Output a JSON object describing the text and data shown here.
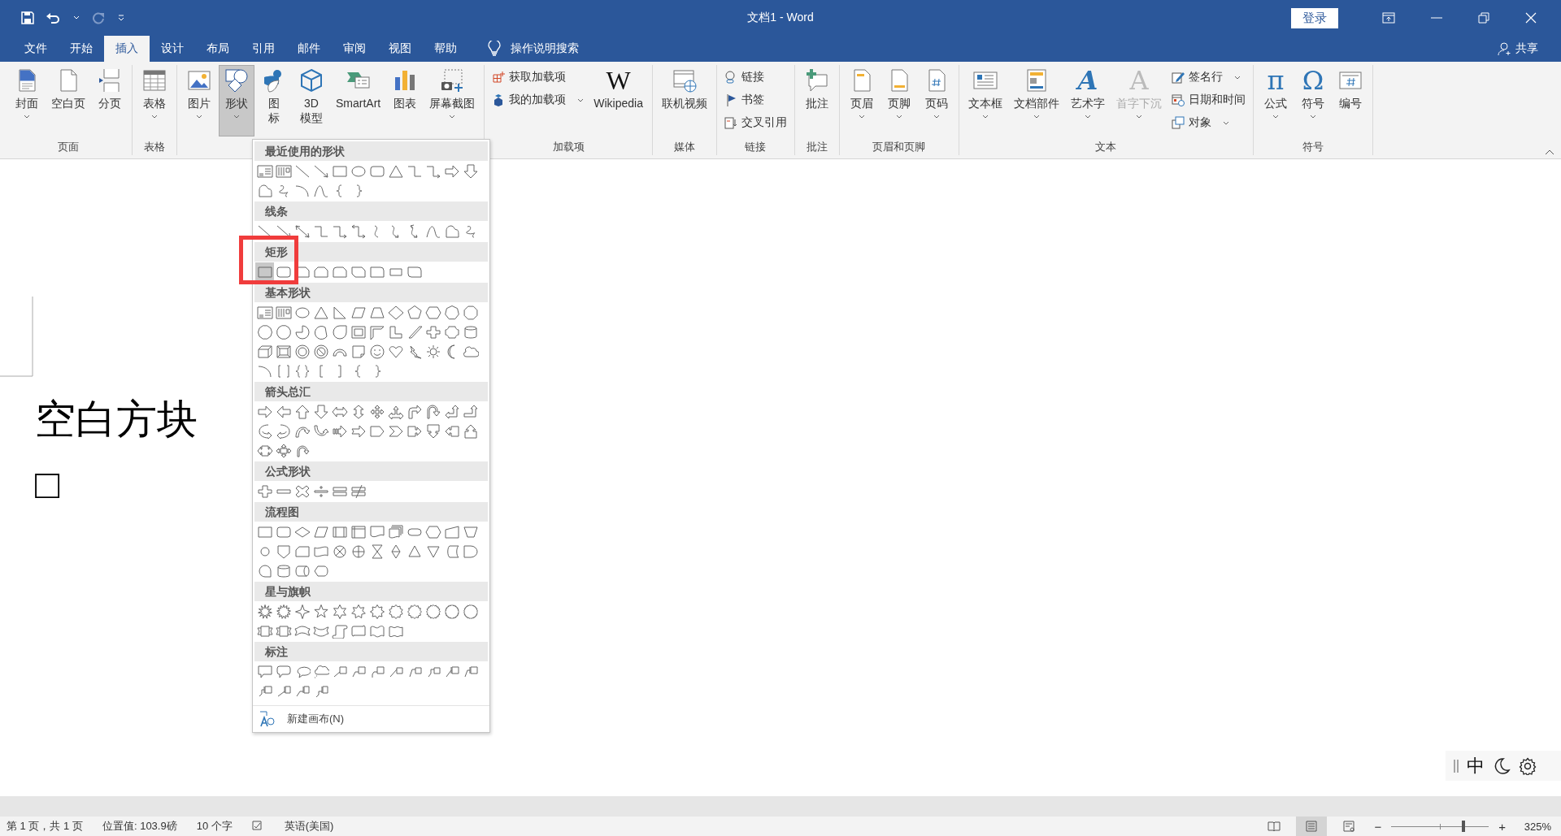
{
  "window": {
    "title": "文档1 - Word",
    "sign_in": "登录"
  },
  "tabs": [
    {
      "label": "文件",
      "selected": false
    },
    {
      "label": "开始",
      "selected": false
    },
    {
      "label": "插入",
      "selected": true
    },
    {
      "label": "设计",
      "selected": false
    },
    {
      "label": "布局",
      "selected": false
    },
    {
      "label": "引用",
      "selected": false
    },
    {
      "label": "邮件",
      "selected": false
    },
    {
      "label": "审阅",
      "selected": false
    },
    {
      "label": "视图",
      "selected": false
    },
    {
      "label": "帮助",
      "selected": false
    }
  ],
  "tell_me": "操作说明搜索",
  "share": "共享",
  "ribbon": {
    "groups": [
      {
        "label": "页面",
        "items": [
          {
            "kind": "large",
            "label": "封面",
            "dropdown": true,
            "pressed": false,
            "disabled": false
          },
          {
            "kind": "large",
            "label": "空白页",
            "dropdown": false,
            "pressed": false,
            "disabled": false
          },
          {
            "kind": "large",
            "label": "分页",
            "dropdown": false,
            "pressed": false,
            "disabled": false
          }
        ]
      },
      {
        "label": "表格",
        "items": [
          {
            "kind": "large",
            "label": "表格",
            "dropdown": true,
            "pressed": false,
            "disabled": false
          }
        ]
      },
      {
        "items": [
          {
            "kind": "large",
            "label": "图片",
            "dropdown": true,
            "pressed": false,
            "disabled": false
          },
          {
            "kind": "large",
            "label": "形状",
            "dropdown": true,
            "pressed": true,
            "disabled": false
          },
          {
            "kind": "large",
            "lines": [
              "图",
              "标"
            ],
            "dropdown": false,
            "pressed": false,
            "disabled": false
          },
          {
            "kind": "large",
            "lines": [
              "3D",
              "模型"
            ],
            "dropdown": false,
            "pressed": false,
            "disabled": false
          },
          {
            "kind": "large",
            "label": "SmartArt",
            "dropdown": false,
            "pressed": false,
            "disabled": false
          },
          {
            "kind": "large",
            "label": "图表",
            "dropdown": false,
            "pressed": false,
            "disabled": false
          },
          {
            "kind": "large",
            "label": "屏幕截图",
            "dropdown": true,
            "pressed": false,
            "disabled": false
          }
        ]
      },
      {
        "label": "加载项",
        "items": [
          {
            "kind": "stack",
            "items": [
              {
                "label": "获取加载项",
                "dropdown": false
              },
              {
                "label": "我的加载项",
                "dropdown": true
              }
            ]
          },
          {
            "kind": "large",
            "glyph": "W",
            "label": "Wikipedia",
            "dropdown": false,
            "pressed": false,
            "disabled": false
          }
        ]
      },
      {
        "label": "媒体",
        "items": [
          {
            "kind": "large",
            "label": "联机视频",
            "dropdown": false,
            "pressed": false,
            "disabled": false
          }
        ]
      },
      {
        "label": "链接",
        "items": [
          {
            "kind": "stack",
            "items": [
              {
                "label": "链接",
                "dropdown": false
              },
              {
                "label": "书签",
                "dropdown": false
              },
              {
                "label": "交叉引用",
                "dropdown": false
              }
            ]
          }
        ]
      },
      {
        "label": "批注",
        "items": [
          {
            "kind": "large",
            "label": "批注",
            "dropdown": false,
            "pressed": false,
            "disabled": false
          }
        ]
      },
      {
        "label": "页眉和页脚",
        "items": [
          {
            "kind": "large",
            "label": "页眉",
            "dropdown": true,
            "pressed": false,
            "disabled": false
          },
          {
            "kind": "large",
            "label": "页脚",
            "dropdown": true,
            "pressed": false,
            "disabled": false
          },
          {
            "kind": "large",
            "label": "页码",
            "dropdown": true,
            "pressed": false,
            "disabled": false
          }
        ]
      },
      {
        "label": "文本",
        "items": [
          {
            "kind": "large",
            "label": "文本框",
            "dropdown": true,
            "pressed": false,
            "disabled": false
          },
          {
            "kind": "large",
            "label": "文档部件",
            "dropdown": true,
            "pressed": false,
            "disabled": false
          },
          {
            "kind": "large",
            "glyph": "A",
            "label": "艺术字",
            "dropdown": true,
            "pressed": false,
            "disabled": false
          },
          {
            "kind": "large",
            "glyph": "A",
            "label": "首字下沉",
            "dropdown": true,
            "pressed": false,
            "disabled": true
          },
          {
            "kind": "stack",
            "items": [
              {
                "label": "签名行",
                "dropdown": true
              },
              {
                "label": "日期和时间",
                "dropdown": false
              },
              {
                "label": "对象",
                "dropdown": true
              }
            ]
          }
        ]
      },
      {
        "label": "符号",
        "items": [
          {
            "kind": "large",
            "glyph": "π",
            "label": "公式",
            "dropdown": true,
            "pressed": false,
            "disabled": false
          },
          {
            "kind": "large",
            "glyph": "Ω",
            "label": "符号",
            "dropdown": true,
            "pressed": false,
            "disabled": false
          },
          {
            "kind": "large",
            "label": "编号",
            "dropdown": false,
            "pressed": false,
            "disabled": false
          }
        ]
      }
    ]
  },
  "shapes_menu": {
    "sections": [
      {
        "title": "最近使用的形状",
        "shapes": [
          {
            "kind": "textbox",
            "selected": false
          },
          {
            "kind": "vtextbox",
            "selected": false
          },
          {
            "kind": "line",
            "selected": false
          },
          {
            "kind": "arrowline",
            "selected": false
          },
          {
            "kind": "rect",
            "selected": false
          },
          {
            "kind": "oval",
            "selected": false
          },
          {
            "kind": "roundrect",
            "selected": false
          },
          {
            "kind": "triangle",
            "selected": false
          },
          {
            "kind": "elbow",
            "selected": false
          },
          {
            "kind": "elbowarrow",
            "selected": false
          },
          {
            "kind": "arrowright",
            "selected": false
          },
          {
            "kind": "arrowdown",
            "selected": false
          },
          {
            "kind": "freeform",
            "selected": false
          },
          {
            "kind": "scribble",
            "selected": false
          },
          {
            "kind": "arc",
            "selected": false
          },
          {
            "kind": "wave",
            "selected": false
          },
          {
            "kind": "lbrace",
            "selected": false
          },
          {
            "kind": "rbrace",
            "selected": false
          }
        ]
      },
      {
        "title": "线条",
        "shapes": [
          {
            "kind": "line",
            "selected": false
          },
          {
            "kind": "arrowline",
            "selected": false
          },
          {
            "kind": "dblarrow",
            "selected": false
          },
          {
            "kind": "elbow",
            "selected": false
          },
          {
            "kind": "elbowarrow",
            "selected": false
          },
          {
            "kind": "elbowdbl",
            "selected": false
          },
          {
            "kind": "curve",
            "selected": false
          },
          {
            "kind": "curvearrow",
            "selected": false
          },
          {
            "kind": "curvedbl",
            "selected": false
          },
          {
            "kind": "wave",
            "selected": false
          },
          {
            "kind": "freeform",
            "selected": false
          },
          {
            "kind": "scribble",
            "selected": false
          }
        ]
      },
      {
        "title": "矩形",
        "shapes": [
          {
            "kind": "rect",
            "selected": true
          },
          {
            "kind": "roundrect",
            "selected": false
          },
          {
            "kind": "snip",
            "selected": false
          },
          {
            "kind": "snip2",
            "selected": false
          },
          {
            "kind": "sniprnd",
            "selected": false
          },
          {
            "kind": "snipdiag",
            "selected": false
          },
          {
            "kind": "round1",
            "selected": false
          },
          {
            "kind": "round2",
            "selected": false
          },
          {
            "kind": "rounddiag",
            "selected": false
          }
        ]
      },
      {
        "title": "基本形状",
        "shapes": [
          {
            "kind": "textbox",
            "selected": false
          },
          {
            "kind": "vtextbox",
            "selected": false
          },
          {
            "kind": "oval",
            "selected": false
          },
          {
            "kind": "triangle",
            "selected": false
          },
          {
            "kind": "rtriangle",
            "selected": false
          },
          {
            "kind": "parallelogram",
            "selected": false
          },
          {
            "kind": "trapezoid",
            "selected": false
          },
          {
            "kind": "diamond",
            "selected": false
          },
          {
            "kind": "pentagon",
            "selected": false
          },
          {
            "kind": "hexagon",
            "selected": false
          },
          {
            "kind": "heptagon",
            "selected": false
          },
          {
            "kind": "octagon",
            "selected": false
          },
          {
            "kind": "decagon",
            "selected": false
          },
          {
            "kind": "dodecagon",
            "selected": false
          },
          {
            "kind": "pie",
            "selected": false
          },
          {
            "kind": "chord",
            "selected": false
          },
          {
            "kind": "teardrop",
            "selected": false
          },
          {
            "kind": "frame",
            "selected": false
          },
          {
            "kind": "halfframe",
            "selected": false
          },
          {
            "kind": "lshape",
            "selected": false
          },
          {
            "kind": "diagstripe",
            "selected": false
          },
          {
            "kind": "cross",
            "selected": false
          },
          {
            "kind": "plaque",
            "selected": false
          },
          {
            "kind": "can",
            "selected": false
          },
          {
            "kind": "cube",
            "selected": false
          },
          {
            "kind": "bevel",
            "selected": false
          },
          {
            "kind": "donut",
            "selected": false
          },
          {
            "kind": "nosymbol",
            "selected": false
          },
          {
            "kind": "blockarc",
            "selected": false
          },
          {
            "kind": "folded",
            "selected": false
          },
          {
            "kind": "smiley",
            "selected": false
          },
          {
            "kind": "heart",
            "selected": false
          },
          {
            "kind": "lightning",
            "selected": false
          },
          {
            "kind": "sun",
            "selected": false
          },
          {
            "kind": "moon",
            "selected": false
          },
          {
            "kind": "cloud",
            "selected": false
          },
          {
            "kind": "arc",
            "selected": false
          },
          {
            "kind": "bracketpair",
            "selected": false
          },
          {
            "kind": "bracepair",
            "selected": false
          },
          {
            "kind": "lbracket",
            "selected": false
          },
          {
            "kind": "rbracket",
            "selected": false
          },
          {
            "kind": "lbrace",
            "selected": false
          },
          {
            "kind": "rbrace",
            "selected": false
          }
        ]
      },
      {
        "title": "箭头总汇",
        "shapes": [
          {
            "kind": "arrowright",
            "selected": false
          },
          {
            "kind": "arrowleft",
            "selected": false
          },
          {
            "kind": "arrowup",
            "selected": false
          },
          {
            "kind": "arrowdown",
            "selected": false
          },
          {
            "kind": "arrowlr",
            "selected": false
          },
          {
            "kind": "arrowud",
            "selected": false
          },
          {
            "kind": "quad",
            "selected": false
          },
          {
            "kind": "lru",
            "selected": false
          },
          {
            "kind": "bentarrow",
            "selected": false
          },
          {
            "kind": "uturn",
            "selected": false
          },
          {
            "kind": "leftup",
            "selected": false
          },
          {
            "kind": "bentup",
            "selected": false
          },
          {
            "kind": "curvedright",
            "selected": false
          },
          {
            "kind": "curvedleft",
            "selected": false
          },
          {
            "kind": "curvedup",
            "selected": false
          },
          {
            "kind": "curveddown",
            "selected": false
          },
          {
            "kind": "striped",
            "selected": false
          },
          {
            "kind": "notched",
            "selected": false
          },
          {
            "kind": "homeplate",
            "selected": false
          },
          {
            "kind": "chevron",
            "selected": false
          },
          {
            "kind": "calloutright",
            "selected": false
          },
          {
            "kind": "calloutdown",
            "selected": false
          },
          {
            "kind": "calloutleft",
            "selected": false
          },
          {
            "kind": "calloutup",
            "selected": false
          },
          {
            "kind": "calloutlr",
            "selected": false
          },
          {
            "kind": "calloutquad",
            "selected": false
          },
          {
            "kind": "circulararrow",
            "selected": false
          }
        ]
      },
      {
        "title": "公式形状",
        "shapes": [
          {
            "kind": "plus",
            "selected": false
          },
          {
            "kind": "minus",
            "selected": false
          },
          {
            "kind": "multiply",
            "selected": false
          },
          {
            "kind": "divide",
            "selected": false
          },
          {
            "kind": "equal",
            "selected": false
          },
          {
            "kind": "notequal",
            "selected": false
          }
        ]
      },
      {
        "title": "流程图",
        "shapes": [
          {
            "kind": "rect",
            "selected": false
          },
          {
            "kind": "roundrect",
            "selected": false
          },
          {
            "kind": "flatdiamond",
            "selected": false
          },
          {
            "kind": "parallelogram",
            "selected": false
          },
          {
            "kind": "predefined",
            "selected": false
          },
          {
            "kind": "internal",
            "selected": false
          },
          {
            "kind": "document",
            "selected": false
          },
          {
            "kind": "multidoc",
            "selected": false
          },
          {
            "kind": "terminator",
            "selected": false
          },
          {
            "kind": "hexagon",
            "selected": false
          },
          {
            "kind": "manualinput",
            "selected": false
          },
          {
            "kind": "manualop",
            "selected": false
          },
          {
            "kind": "connector",
            "selected": false
          },
          {
            "kind": "offpage",
            "selected": false
          },
          {
            "kind": "card",
            "selected": false
          },
          {
            "kind": "tape",
            "selected": false
          },
          {
            "kind": "summing",
            "selected": false
          },
          {
            "kind": "orflow",
            "selected": false
          },
          {
            "kind": "collate",
            "selected": false
          },
          {
            "kind": "sort",
            "selected": false
          },
          {
            "kind": "extract",
            "selected": false
          },
          {
            "kind": "merge",
            "selected": false
          },
          {
            "kind": "stored",
            "selected": false
          },
          {
            "kind": "delay",
            "selected": false
          },
          {
            "kind": "sequential",
            "selected": false
          },
          {
            "kind": "can",
            "selected": false
          },
          {
            "kind": "directaccess",
            "selected": false
          },
          {
            "kind": "display",
            "selected": false
          }
        ]
      },
      {
        "title": "星与旗帜",
        "shapes": [
          {
            "kind": "explosion",
            "selected": false
          },
          {
            "kind": "explosion2",
            "selected": false
          },
          {
            "kind": "star4",
            "selected": false
          },
          {
            "kind": "star5",
            "selected": false
          },
          {
            "kind": "star6",
            "selected": false
          },
          {
            "kind": "star7",
            "selected": false
          },
          {
            "kind": "star8",
            "selected": false
          },
          {
            "kind": "star10",
            "selected": false
          },
          {
            "kind": "star12",
            "selected": false
          },
          {
            "kind": "star16",
            "selected": false
          },
          {
            "kind": "star24",
            "selected": false
          },
          {
            "kind": "star32",
            "selected": false
          },
          {
            "kind": "ribbondown",
            "selected": false
          },
          {
            "kind": "ribbonup",
            "selected": false
          },
          {
            "kind": "cribbondown",
            "selected": false
          },
          {
            "kind": "cribbonup",
            "selected": false
          },
          {
            "kind": "vscroll",
            "selected": false
          },
          {
            "kind": "hscroll",
            "selected": false
          },
          {
            "kind": "wavebanner",
            "selected": false
          },
          {
            "kind": "dwave",
            "selected": false
          }
        ]
      },
      {
        "title": "标注",
        "shapes": [
          {
            "kind": "callrect",
            "selected": false
          },
          {
            "kind": "callround",
            "selected": false
          },
          {
            "kind": "calloval",
            "selected": false
          },
          {
            "kind": "callcloud",
            "selected": false
          },
          {
            "kind": "lc1",
            "selected": false
          },
          {
            "kind": "lc2",
            "selected": false
          },
          {
            "kind": "lc3",
            "selected": false
          },
          {
            "kind": "lc1n",
            "selected": false
          },
          {
            "kind": "lc2n",
            "selected": false
          },
          {
            "kind": "lc3n",
            "selected": false
          },
          {
            "kind": "lc1b",
            "selected": false
          },
          {
            "kind": "lc2b",
            "selected": false
          },
          {
            "kind": "lc3b",
            "selected": false
          },
          {
            "kind": "lc1a",
            "selected": false
          },
          {
            "kind": "lc2a",
            "selected": false
          },
          {
            "kind": "lc3a",
            "selected": false
          }
        ]
      }
    ],
    "footer": "新建画布(N)"
  },
  "annotation": {
    "kind": "box"
  },
  "document": {
    "lines": [
      "空白方块",
      "□"
    ]
  },
  "ime_toolbar": {
    "mode": "中"
  },
  "status_bar": {
    "left": [
      {
        "kind": "text",
        "text": "第 1 页，共 1 页"
      },
      {
        "kind": "text",
        "text": "位置值: 103.9磅"
      },
      {
        "kind": "text",
        "text": "10 个字"
      },
      {
        "kind": "proofing"
      },
      {
        "kind": "text",
        "text": "英语(美国)"
      }
    ],
    "views": [
      {
        "kind": "read",
        "selected": false
      },
      {
        "kind": "print",
        "selected": true
      },
      {
        "kind": "web",
        "selected": false
      }
    ],
    "zoom": {
      "minus": "−",
      "plus": "+",
      "level": 0.74,
      "reading": "325%"
    }
  }
}
